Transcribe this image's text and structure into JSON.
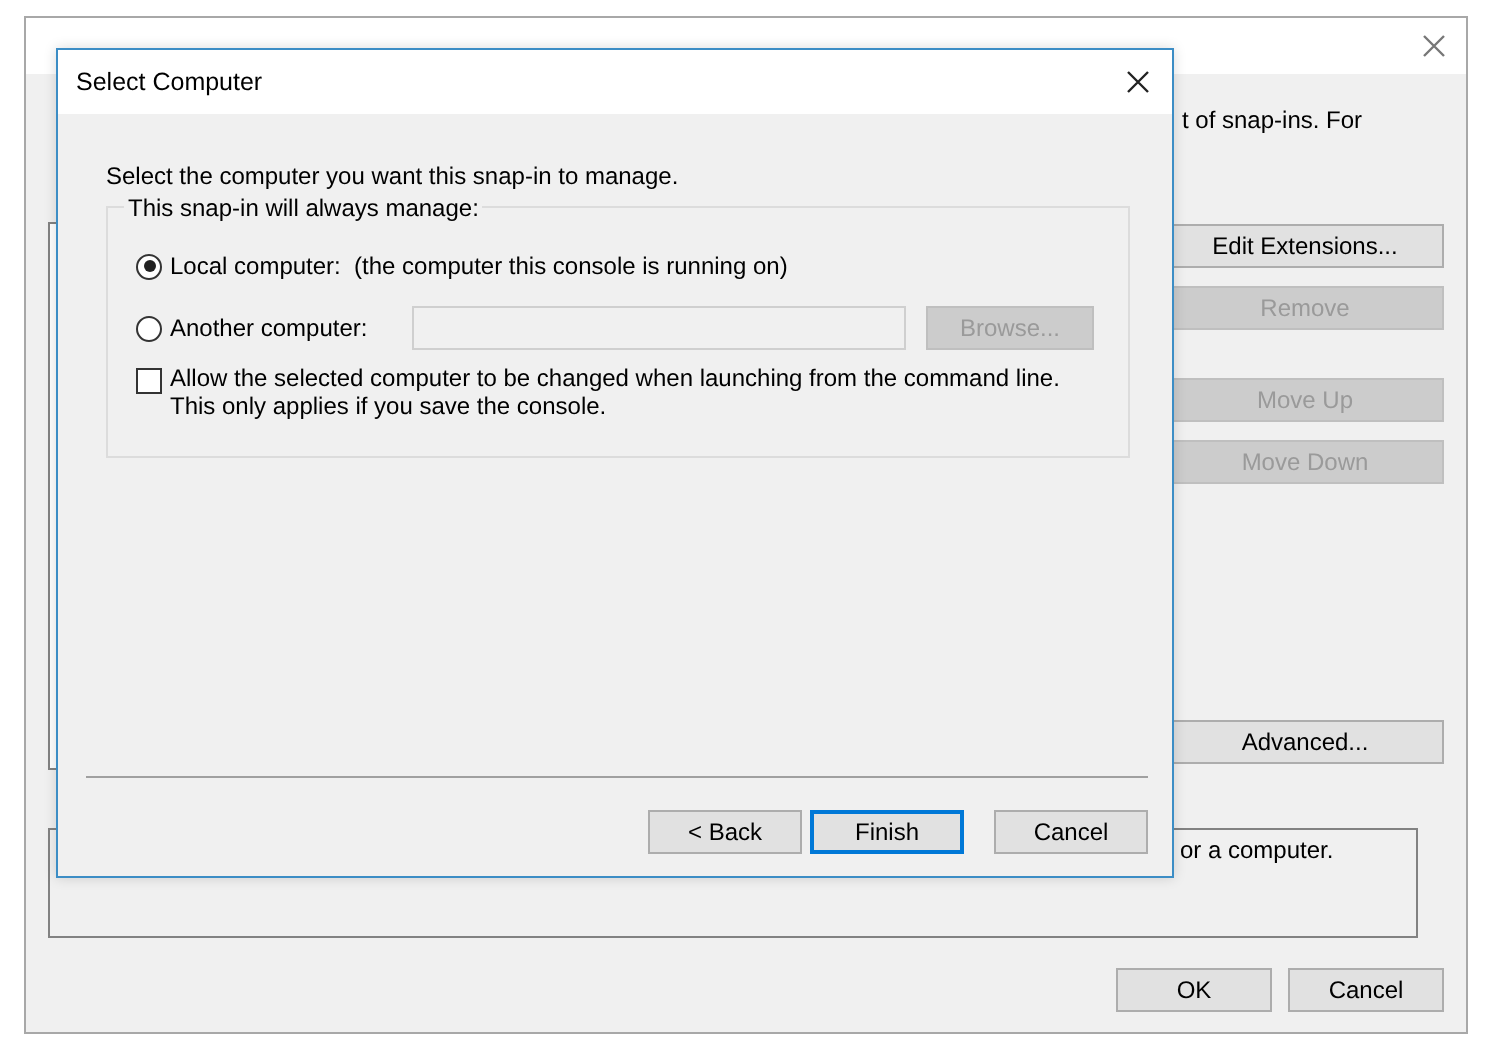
{
  "background_window": {
    "intro_fragment": "t of snap-ins. For",
    "side_buttons": [
      {
        "label": "Edit Extensions...",
        "disabled": false
      },
      {
        "label": "Remove",
        "disabled": true
      },
      {
        "label": "Move Up",
        "disabled": true
      },
      {
        "label": "Move Down",
        "disabled": true
      },
      {
        "label": "Advanced...",
        "disabled": false
      }
    ],
    "description_fragment": "or a computer.",
    "footer_buttons": [
      {
        "label": "OK"
      },
      {
        "label": "Cancel"
      }
    ]
  },
  "dialog": {
    "title": "Select Computer",
    "instruction": "Select the computer you want this snap-in to manage.",
    "group_label": "This snap-in will always manage:",
    "options": [
      {
        "label": "Local computer:  (the computer this console is running on)",
        "selected": true
      },
      {
        "label": "Another computer:",
        "selected": false
      }
    ],
    "browse_button": {
      "label": "Browse...",
      "disabled": true
    },
    "allow_change": {
      "label": "Allow the selected computer to be changed when launching from the command line.  This only applies if you save the console.",
      "checked": false
    },
    "buttons": [
      {
        "label": "< Back",
        "default": false
      },
      {
        "label": "Finish",
        "default": true
      },
      {
        "label": "Cancel",
        "default": false
      }
    ]
  }
}
